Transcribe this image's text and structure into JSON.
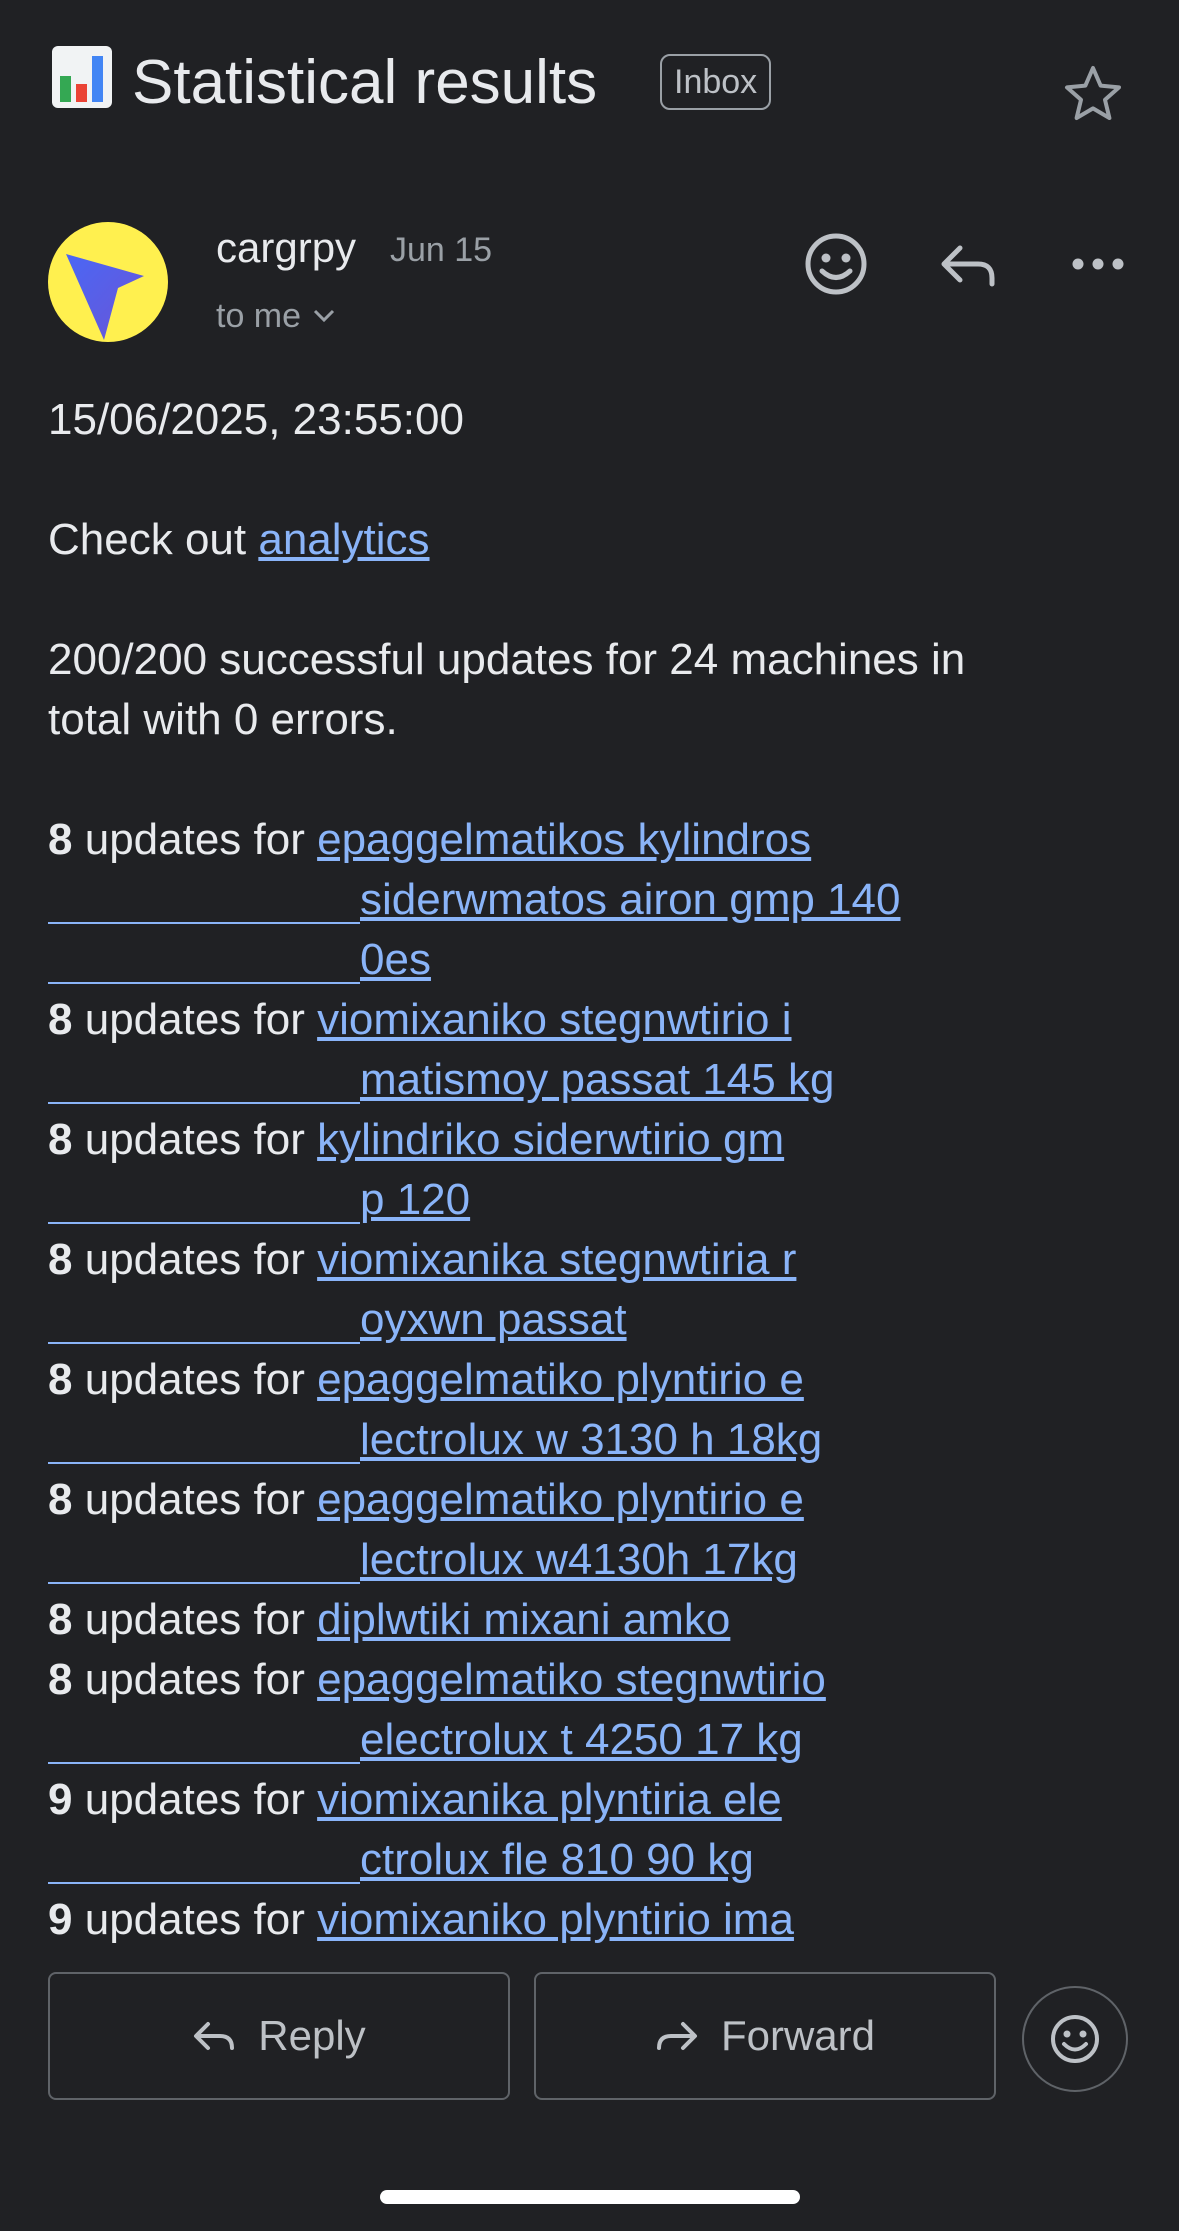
{
  "subject": {
    "title": "Statistical results",
    "badge": "Inbox",
    "icon": "bar-chart-emoji"
  },
  "sender": {
    "name": "cargrpy",
    "date": "Jun 15",
    "recipient": "to me"
  },
  "message": {
    "timestamp": "15/06/2025, 23:55:00",
    "check_prefix": "Check out ",
    "check_link": "analytics",
    "summary": "200/200 successful updates for 24 machines in total with 0 errors.",
    "updates_word": "updates for",
    "updates": [
      {
        "count": "8",
        "line1": "epaggelmatikos kylindros",
        "line2": "siderwmatos airon gmp 140",
        "line3": "0es"
      },
      {
        "count": "8",
        "line1": "viomixaniko stegnwtirio i",
        "line2": "matismoy passat 145 kg",
        "line3": ""
      },
      {
        "count": "8",
        "line1": "kylindriko siderwtirio gm",
        "line2": "p 120",
        "line3": ""
      },
      {
        "count": "8",
        "line1": "viomixanika stegnwtiria r",
        "line2": "oyxwn passat",
        "line3": ""
      },
      {
        "count": "8",
        "line1": "epaggelmatiko plyntirio e",
        "line2": "lectrolux w 3130 h 18kg",
        "line3": ""
      },
      {
        "count": "8",
        "line1": "epaggelmatiko plyntirio e",
        "line2": "lectrolux w4130h 17kg",
        "line3": ""
      },
      {
        "count": "8",
        "line1": "diplwtiki mixani amko",
        "line2": "",
        "line3": ""
      },
      {
        "count": "8",
        "line1": "epaggelmatiko stegnwtirio",
        "line2": "electrolux t 4250 17 kg",
        "line3": ""
      },
      {
        "count": "9",
        "line1": "viomixanika plyntiria ele",
        "line2": "ctrolux fle 810 90 kg",
        "line3": ""
      },
      {
        "count": "9",
        "line1": "viomixaniko plyntirio ima",
        "line2": "",
        "line3": ""
      }
    ]
  },
  "actions": {
    "reply_label": "Reply",
    "forward_label": "Forward"
  },
  "colors": {
    "background": "#202124",
    "link": "#8ab4f8",
    "avatar_bg": "#fff04f",
    "avatar_fg": "#4f6bf0"
  }
}
